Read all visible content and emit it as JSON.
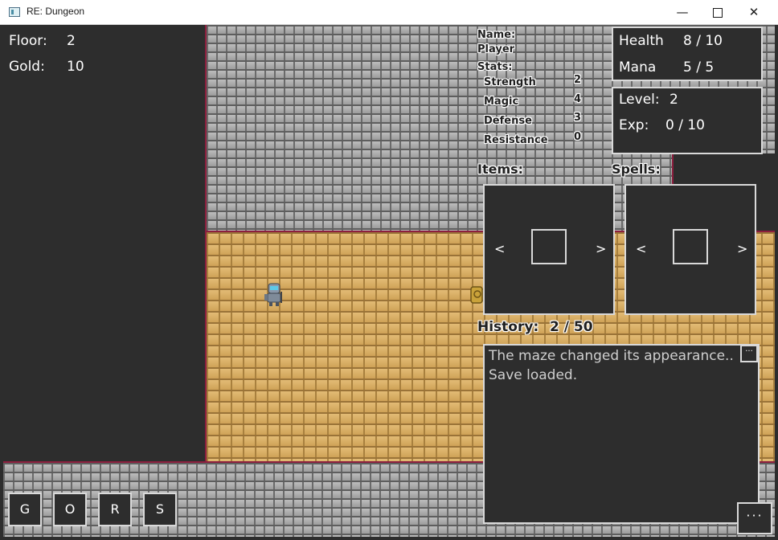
{
  "window": {
    "title": "RE: Dungeon",
    "minimize": "—",
    "close": "✕"
  },
  "floor": {
    "label": "Floor:",
    "value": "2"
  },
  "gold": {
    "label": "Gold:",
    "value": "10"
  },
  "health": {
    "label": "Health",
    "value": "8 / 10"
  },
  "mana": {
    "label": "Mana",
    "value": "5 / 5"
  },
  "level": {
    "label": "Level:",
    "value": "2"
  },
  "exp": {
    "label": "Exp:",
    "value": "0 / 10"
  },
  "character": {
    "name_label": "Name:",
    "name_value": "Player",
    "stats_label": "Stats:",
    "stats": [
      {
        "label": "Strength",
        "value": "2"
      },
      {
        "label": "Magic",
        "value": "4"
      },
      {
        "label": "Defense",
        "value": "3"
      },
      {
        "label": "Resistance",
        "value": "0"
      }
    ]
  },
  "items": {
    "label": "Items:",
    "prev": "<",
    "next": ">"
  },
  "spells": {
    "label": "Spells:",
    "prev": "<",
    "next": ">"
  },
  "history": {
    "label": "History:",
    "count": "2 / 50",
    "lines": [
      "The maze changed its appearance..",
      "Save loaded."
    ],
    "more_button": "···"
  },
  "action_buttons": [
    "G",
    "O",
    "R",
    "S"
  ],
  "menu_button": "···",
  "colors": {
    "wall_trim": "#8c1f3e",
    "panel_bg": "#2d2d2d",
    "panel_border": "#d9d9d9"
  },
  "sprites": {
    "player": "knight-sprite",
    "chest": "chest-sprite"
  }
}
